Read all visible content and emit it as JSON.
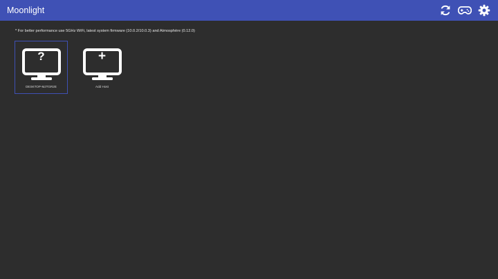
{
  "app": {
    "title": "Moonlight"
  },
  "header": {
    "actions": [
      {
        "icon": "refresh-icon"
      },
      {
        "icon": "gamepad-icon"
      },
      {
        "icon": "gear-icon"
      }
    ]
  },
  "hint": "* For better performance use 5GHz WiFi, latest system firmware (10.0.2/10.0.3) and Atmosphère (0.12.0)",
  "hosts": [
    {
      "label": "DESKTOP-MJTGR2E",
      "glyph": "?",
      "selected": true
    },
    {
      "label": "Add Host",
      "glyph": "+",
      "selected": false
    }
  ],
  "colors": {
    "header": "#3f51b5",
    "background": "#2d2d2d",
    "selection": "#3f51b5",
    "icon": "#ffffff"
  }
}
